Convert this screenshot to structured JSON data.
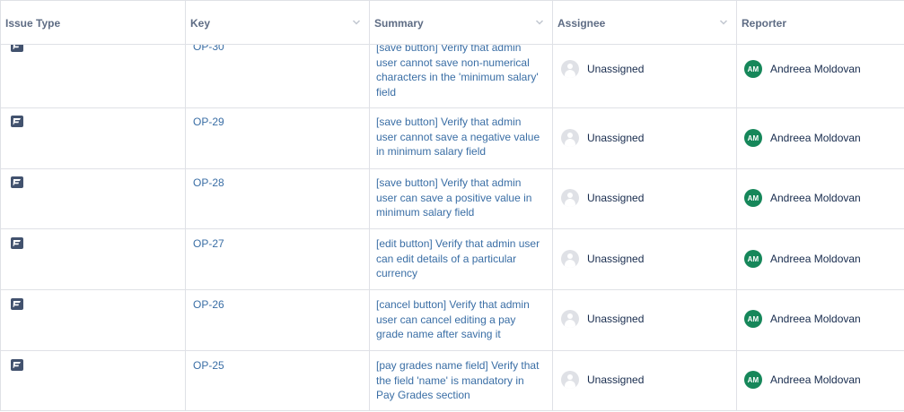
{
  "table": {
    "columns": [
      {
        "label": "Issue Type",
        "sortable": false
      },
      {
        "label": "Key",
        "sortable": true
      },
      {
        "label": "Summary",
        "sortable": true
      },
      {
        "label": "Assignee",
        "sortable": true
      },
      {
        "label": "Reporter",
        "sortable": false
      }
    ],
    "rows": [
      {
        "issue_type_icon": "test-issue-icon",
        "key": "OP-30",
        "summary": "[save button] Verify that admin user cannot save non-numerical characters in the 'minimum salary' field",
        "assignee": "Unassigned",
        "reporter": "Andreea Moldovan",
        "reporter_initials": "AM"
      },
      {
        "issue_type_icon": "test-issue-icon",
        "key": "OP-29",
        "summary": "[save button] Verify that admin user cannot save a negative value in minimum salary field",
        "assignee": "Unassigned",
        "reporter": "Andreea Moldovan",
        "reporter_initials": "AM"
      },
      {
        "issue_type_icon": "test-issue-icon",
        "key": "OP-28",
        "summary": "[save button] Verify that admin user can save a positive value in minimum salary field",
        "assignee": "Unassigned",
        "reporter": "Andreea Moldovan",
        "reporter_initials": "AM"
      },
      {
        "issue_type_icon": "test-issue-icon",
        "key": "OP-27",
        "summary": "[edit button] Verify that admin user can edit details of a particular currency",
        "assignee": "Unassigned",
        "reporter": "Andreea Moldovan",
        "reporter_initials": "AM"
      },
      {
        "issue_type_icon": "test-issue-icon",
        "key": "OP-26",
        "summary": "[cancel button] Verify that admin user can cancel editing a pay grade name after saving it",
        "assignee": "Unassigned",
        "reporter": "Andreea Moldovan",
        "reporter_initials": "AM"
      },
      {
        "issue_type_icon": "test-issue-icon",
        "key": "OP-25",
        "summary": "[pay grades name field] Verify that the field 'name' is mandatory in Pay Grades section",
        "assignee": "Unassigned",
        "reporter": "Andreea Moldovan",
        "reporter_initials": "AM"
      }
    ]
  },
  "colors": {
    "link": "#3a6ea5",
    "reporter_avatar": "#16875a",
    "border": "#dfe1e6",
    "header_text": "#5e6c84"
  }
}
